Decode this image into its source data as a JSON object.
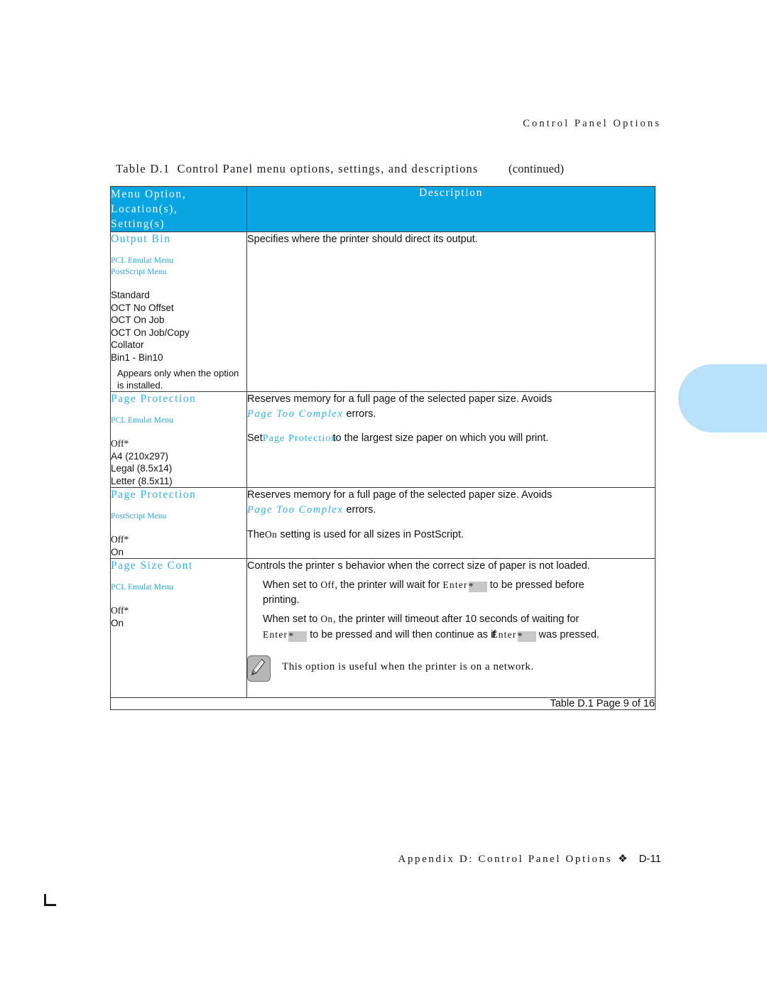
{
  "page": {
    "running_head": "Control Panel Options",
    "footer_text": "Appendix D: Control Panel Options",
    "footer_diamond": "❖",
    "folio": "D-11"
  },
  "caption": {
    "label": "Table D.1",
    "main": "Control Panel menu options, settings, and descriptions",
    "continued": "(continued)"
  },
  "table": {
    "headers": {
      "option": "Menu Option, Location(s), Setting(s)",
      "option_line1": "Menu Option,",
      "option_line2": "Location(s),",
      "option_line3": "Setting(s)",
      "description": "Description"
    },
    "footer_note": "Table D.1  Page 9 of 16",
    "rows": [
      {
        "title": "Output Bin",
        "locations": [
          "PCL Emulat Menu",
          "PostScript Menu"
        ],
        "settings": [
          "Standard",
          "OCT No Offset",
          "OCT On Job",
          "OCT On Job/Copy",
          "Collator",
          "Bin1 - Bin10"
        ],
        "note": "Appears only when the option is installed.",
        "description_lines": [
          "Specifies where the printer should direct its output."
        ]
      },
      {
        "title": "Page Protection",
        "locations": [
          "PCL Emulat Menu"
        ],
        "settings": [
          "Off*",
          "A4 (210x297)",
          "Legal (8.5x14)",
          "Letter (8.5x11)"
        ],
        "note": "",
        "desc_p1_a": "Reserves memory for a full page of the selected paper size. Avoids",
        "desc_p1_term": "Page Too Complex",
        "desc_p1_b": "errors.",
        "desc_p2_a": "Set",
        "desc_p2_term": "Page Protection",
        "desc_p2_b": "to the largest size paper on which you will print."
      },
      {
        "title": "Page Protection",
        "locations": [
          "PostScript Menu"
        ],
        "settings": [
          "Off*",
          "On"
        ],
        "note": "",
        "desc_p1_a": "Reserves memory for a full page of the selected paper size. Avoids",
        "desc_p1_term": "Page Too Complex",
        "desc_p1_b": "errors.",
        "desc_p2_a": "The",
        "desc_p2_term": "On",
        "desc_p2_b": "setting is used for all sizes in PostScript."
      },
      {
        "title": "Page Size Cont",
        "locations": [
          "PCL Emulat Menu"
        ],
        "settings": [
          "Off*",
          "On"
        ],
        "note": "",
        "desc_intro": "Controls the printer s behavior when the correct size of paper is not loaded.",
        "desc_b1_a": "When set to",
        "desc_b1_lit": "Off",
        "desc_b1_b": ", the printer will wait for",
        "desc_b1_key": "Enter",
        "desc_b1_keystar": "*",
        "desc_b1_c": "to be pressed before",
        "desc_b1_d": "printing.",
        "desc_b2_a": "When set to",
        "desc_b2_lit": "On",
        "desc_b2_b": ", the printer will timeout after 10 seconds of waiting for",
        "desc_b2_key": "Enter",
        "desc_b2_keystar": "*",
        "desc_b2_c": "to be pressed and will then continue as if",
        "desc_b2_key2": "Enter",
        "desc_b2_keystar2": "*",
        "desc_b2_d": "was pressed.",
        "note_text": "This option is useful when the printer is on a network.",
        "note_icon": "pencil-icon"
      }
    ]
  },
  "colors": {
    "header_band": "#09a5e3",
    "accent_blue": "#2bb2ea",
    "thumb_tab": "#b9e2fa",
    "keycap_gray": "#c8c8c8"
  }
}
